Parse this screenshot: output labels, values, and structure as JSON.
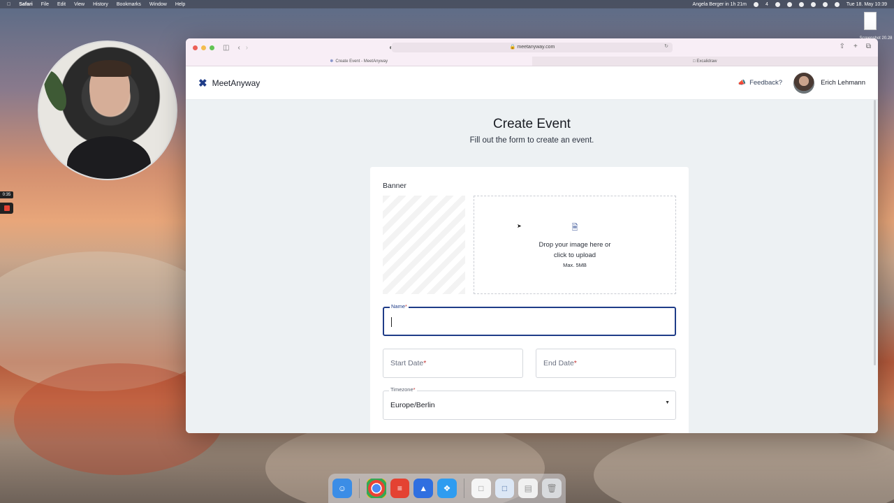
{
  "menubar": {
    "app": "Safari",
    "items": [
      "File",
      "Edit",
      "View",
      "History",
      "Bookmarks",
      "Window",
      "Help"
    ],
    "status_event": "Angela Berger in 1h 21m",
    "badge": "4",
    "datetime": "Tue 18. May 10:39"
  },
  "desktop": {
    "file_label": "Screenshot 20.28"
  },
  "recorder": {
    "timer": "0:35"
  },
  "browser": {
    "url": "meetanyway.com",
    "tabs": [
      {
        "title": "Create Event - MeetAnyway",
        "active": true
      },
      {
        "title": "Excalidraw",
        "active": false
      }
    ]
  },
  "app": {
    "brand": "MeetAnyway",
    "feedback": "Feedback?",
    "user_name": "Erich Lehmann",
    "accent_color": "#1f3c88"
  },
  "page": {
    "title": "Create Event",
    "subtitle": "Fill out the form to create an event."
  },
  "form": {
    "banner_label": "Banner",
    "dropzone_line1": "Drop your image here or",
    "dropzone_line2": "click to upload",
    "dropzone_max": "Max. 5MB",
    "name_label": "Name",
    "name_value": "",
    "start_date_placeholder": "Start Date",
    "end_date_placeholder": "End Date",
    "timezone_label": "Timezone",
    "timezone_value": "Europe/Berlin",
    "required_mark": "*"
  },
  "icons": {
    "logo": "meetanyway-logo-icon",
    "feedback": "megaphone-icon",
    "upload": "file-upload-icon",
    "dropdown": "chevron-down-icon"
  }
}
